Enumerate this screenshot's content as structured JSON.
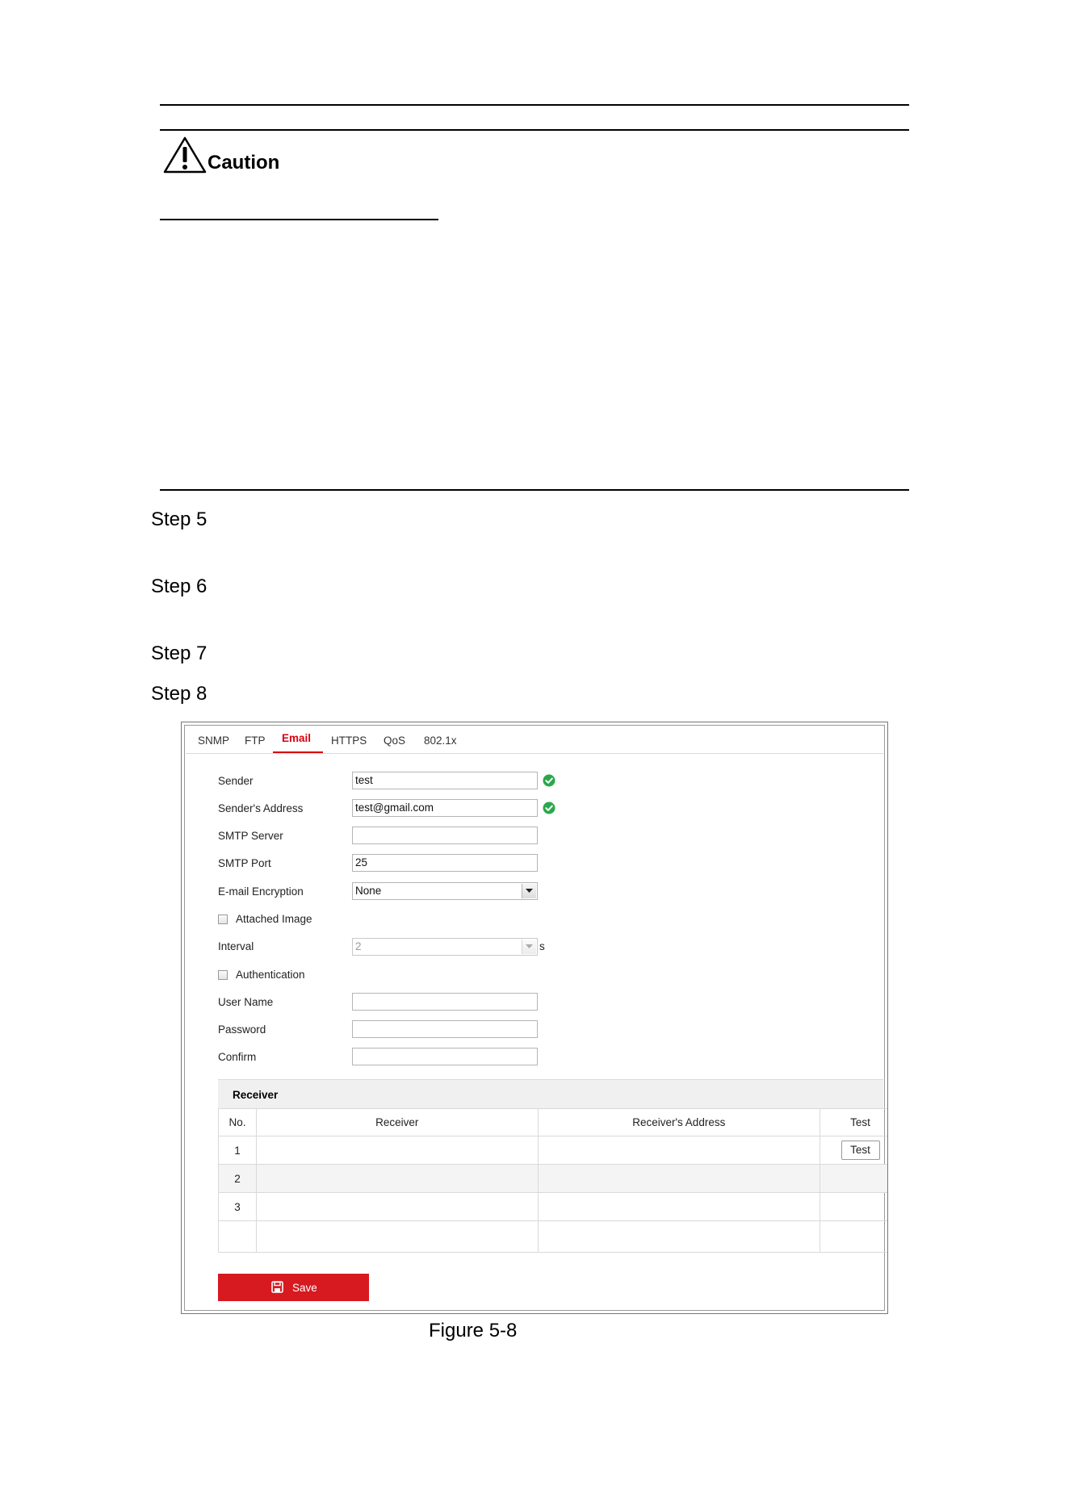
{
  "doc": {
    "caution_label": "Caution",
    "steps": [
      "Step 5",
      "Step 6",
      "Step 7",
      "Step 8"
    ],
    "figure_caption": "Figure 5-8"
  },
  "ui": {
    "tabs": [
      {
        "label": "SNMP"
      },
      {
        "label": "FTP"
      },
      {
        "label": "Email",
        "active": true
      },
      {
        "label": "HTTPS"
      },
      {
        "label": "QoS"
      },
      {
        "label": "802.1x"
      }
    ],
    "form": {
      "sender_label": "Sender",
      "sender_value": "test",
      "sender_address_label": "Sender's Address",
      "sender_address_value": "test@gmail.com",
      "smtp_server_label": "SMTP Server",
      "smtp_server_value": "",
      "smtp_port_label": "SMTP Port",
      "smtp_port_value": "25",
      "encryption_label": "E-mail Encryption",
      "encryption_value": "None",
      "attached_image_label": "Attached Image",
      "attached_image_checked": false,
      "interval_label": "Interval",
      "interval_value": "2",
      "interval_unit": "s",
      "authentication_label": "Authentication",
      "authentication_checked": false,
      "username_label": "User Name",
      "username_value": "",
      "password_label": "Password",
      "password_value": "",
      "confirm_label": "Confirm",
      "confirm_value": ""
    },
    "receiver": {
      "title": "Receiver",
      "columns": [
        "No.",
        "Receiver",
        "Receiver's Address",
        "Test"
      ],
      "rows": [
        {
          "no": "1",
          "receiver": "",
          "address": "",
          "test_label": "Test"
        },
        {
          "no": "2",
          "receiver": "",
          "address": ""
        },
        {
          "no": "3",
          "receiver": "",
          "address": ""
        }
      ]
    },
    "save_label": "Save",
    "colors": {
      "accent": "#d7000f",
      "ok": "#2aa84a",
      "save_bg": "#d71920"
    }
  }
}
